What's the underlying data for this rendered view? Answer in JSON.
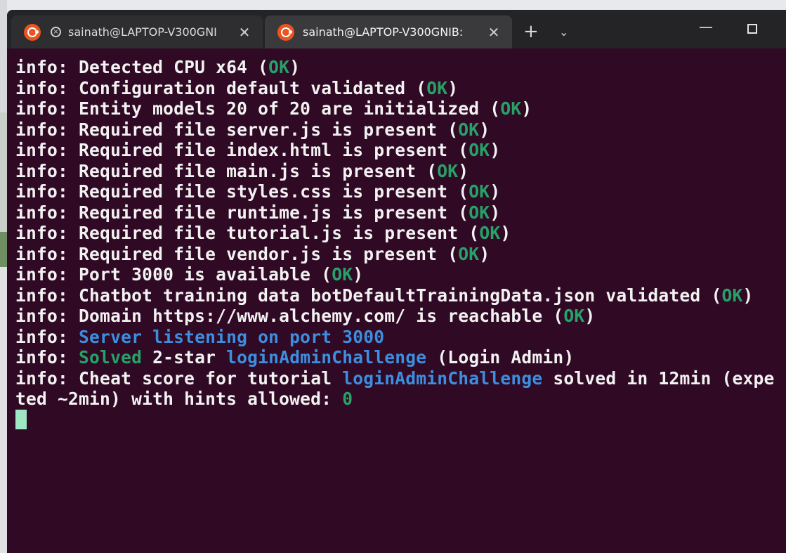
{
  "window": {
    "tabs": [
      {
        "title": "sainath@LAPTOP-V300GNI",
        "close": "✕"
      },
      {
        "title": "sainath@LAPTOP-V300GNIB:",
        "close": "✕"
      }
    ],
    "new_tab": "+",
    "dropdown": "⌄",
    "minimize": "—"
  },
  "terminal": {
    "lines": [
      {
        "prefix": "info: ",
        "text": "Detected CPU x64 (",
        "ok": "OK",
        "suffix": ")"
      },
      {
        "prefix": "info: ",
        "text": "Configuration default validated (",
        "ok": "OK",
        "suffix": ")"
      },
      {
        "prefix": "info: ",
        "text": "Entity models 20 of 20 are initialized (",
        "ok": "OK",
        "suffix": ")"
      },
      {
        "prefix": "info: ",
        "text": "Required file server.js is present (",
        "ok": "OK",
        "suffix": ")"
      },
      {
        "prefix": "info: ",
        "text": "Required file index.html is present (",
        "ok": "OK",
        "suffix": ")"
      },
      {
        "prefix": "info: ",
        "text": "Required file main.js is present (",
        "ok": "OK",
        "suffix": ")"
      },
      {
        "prefix": "info: ",
        "text": "Required file styles.css is present (",
        "ok": "OK",
        "suffix": ")"
      },
      {
        "prefix": "info: ",
        "text": "Required file runtime.js is present (",
        "ok": "OK",
        "suffix": ")"
      },
      {
        "prefix": "info: ",
        "text": "Required file tutorial.js is present (",
        "ok": "OK",
        "suffix": ")"
      },
      {
        "prefix": "info: ",
        "text": "Required file vendor.js is present (",
        "ok": "OK",
        "suffix": ")"
      },
      {
        "prefix": "info: ",
        "text": "Port 3000 is available (",
        "ok": "OK",
        "suffix": ")"
      },
      {
        "prefix": "info: ",
        "text": "Chatbot training data botDefaultTrainingData.json validated (",
        "ok": "OK",
        "suffix": ")"
      },
      {
        "prefix": "info: ",
        "text": "Domain https://www.alchemy.com/ is reachable (",
        "ok": "OK",
        "suffix": ")"
      }
    ],
    "server_line": {
      "prefix": "info: ",
      "highlight": "Server listening on port 3000"
    },
    "solved_line": {
      "prefix": "info: ",
      "solved": "Solved",
      "stars": " 2-star ",
      "challenge": "loginAdminChallenge",
      "rest": " (Login Admin)"
    },
    "cheat_line": {
      "prefix": "info: ",
      "text": "Cheat score for tutorial ",
      "challenge": "loginAdminChallenge",
      "rest": " solved in 12min (expe",
      "wrap": "ted ~2min) with hints allowed: ",
      "score": "0"
    }
  }
}
